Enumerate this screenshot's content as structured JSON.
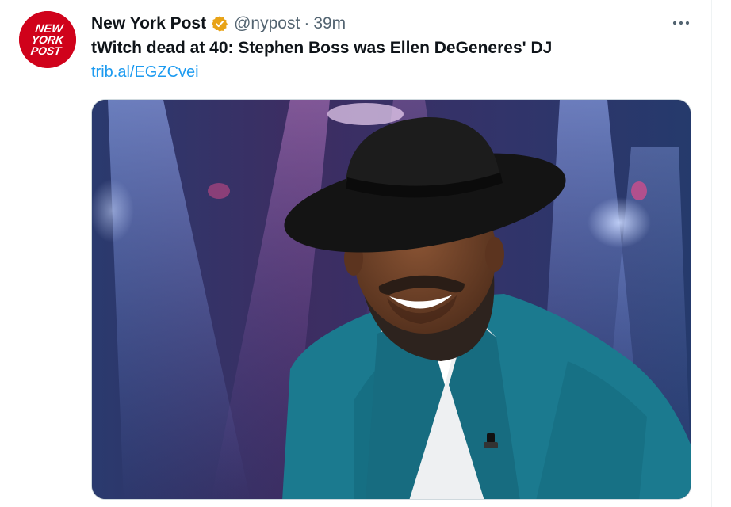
{
  "tweet": {
    "author_name": "New York Post",
    "handle": "@nypost",
    "separator": "·",
    "time": "39m",
    "more_label": "•••",
    "text": "tWitch dead at 40: Stephen Boss was Ellen DeGeneres' DJ",
    "link": "trib.al/EGZCvei"
  },
  "avatar": {
    "logo_lines": [
      "NEW",
      "YORK",
      "POST"
    ],
    "logo_color": "#d0021b"
  },
  "icons": {
    "verified": "verified-badge-icon",
    "more": "more-options-icon"
  },
  "colors": {
    "link": "#1d9bf0",
    "verified_badge": "#e8a317",
    "secondary_text": "#536471",
    "jacket": "#1b7a8f"
  }
}
